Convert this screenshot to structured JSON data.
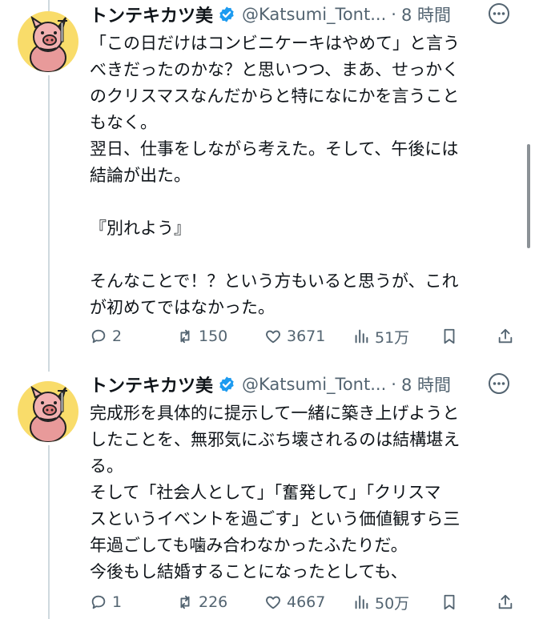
{
  "tweets": [
    {
      "author_name": "トンテキカツ美",
      "handle": "@Katsumi_Tont...",
      "dot": "·",
      "time": "8 時間",
      "lines": [
        "「この日だけはコンビニケーキはやめて」と言う",
        "べきだったのかな？と思いつつ、まあ、せっかく",
        "のクリスマスなんだからと特になにかを言うこと",
        "もなく。",
        "翌日、仕事をしながら考えた。そして、午後には",
        "結論が出た。",
        "",
        "『別れよう』",
        "",
        "そんなことで！？という方もいると思うが、これ",
        "が初めてではなかった。"
      ],
      "replies": "2",
      "reposts": "150",
      "likes": "3671",
      "views": "51万"
    },
    {
      "author_name": "トンテキカツ美",
      "handle": "@Katsumi_Tont...",
      "dot": "·",
      "time": "8 時間",
      "lines": [
        "完成形を具体的に提示して一緒に築き上げようと",
        "したことを、無邪気にぶち壊されるのは結構堪え",
        "る。",
        "そして「社会人として」「奮発して」「クリスマ",
        "スというイベントを過ごす」という価値観すら三",
        "年過ごしても噛み合わなかったふたりだ。",
        "今後もし結婚することになったとしても、"
      ],
      "replies": "1",
      "reposts": "226",
      "likes": "4667",
      "views": "50万"
    }
  ],
  "colors": {
    "text": "#0f1419",
    "secondary": "#536471",
    "verified": "#1d9bf0",
    "avatar_bg": "#f9dc6a",
    "thread_line": "#cfd9de"
  },
  "icons": [
    "verified-badge-icon",
    "more-icon",
    "reply-icon",
    "repost-icon",
    "like-icon",
    "views-icon",
    "bookmark-icon",
    "share-icon"
  ]
}
